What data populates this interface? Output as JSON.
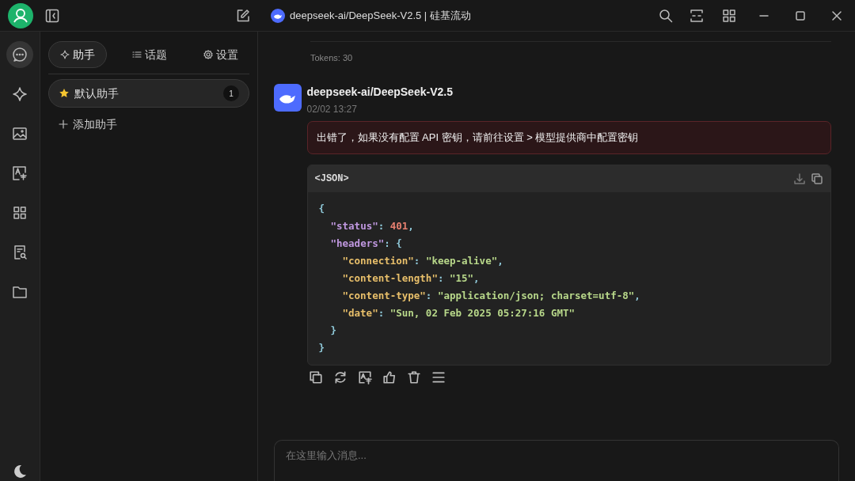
{
  "window": {
    "title": "deepseek-ai/DeepSeek-V2.5 | 硅基流动"
  },
  "rail": {
    "items": [
      {
        "kind": "chat",
        "selected": true
      },
      {
        "kind": "sparkle",
        "selected": false
      },
      {
        "kind": "image",
        "selected": false
      },
      {
        "kind": "translate",
        "selected": false
      },
      {
        "kind": "apps",
        "selected": false
      },
      {
        "kind": "doc-search",
        "selected": false
      },
      {
        "kind": "folder",
        "selected": false
      }
    ]
  },
  "panel": {
    "tabs": [
      {
        "kind": "assistants",
        "label": "助手",
        "selected": true
      },
      {
        "kind": "topics",
        "label": "话题",
        "selected": false
      },
      {
        "kind": "settings",
        "label": "设置",
        "selected": false
      }
    ],
    "assistants": [
      {
        "name": "默认助手",
        "count": "1",
        "selected": true
      }
    ],
    "add_label": "添加助手"
  },
  "chat": {
    "tokens": "Tokens: 30",
    "message": {
      "author": "deepseek-ai/DeepSeek-V2.5",
      "time": "02/02 13:27",
      "error": "出错了，如果没有配置 API 密钥，请前往设置 > 模型提供商中配置密钥",
      "code": {
        "language": "<JSON>",
        "lines": [
          {
            "tokens": [
              {
                "kind": "punct",
                "text": "{"
              }
            ],
            "children": [
              {
                "tokens": [
                  {
                    "kind": "key",
                    "text": "\"status\""
                  },
                  {
                    "kind": "punct",
                    "text": ": "
                  },
                  {
                    "kind": "number",
                    "text": "401"
                  },
                  {
                    "kind": "punct",
                    "text": ","
                  }
                ]
              },
              {
                "tokens": [
                  {
                    "kind": "key",
                    "text": "\"headers\""
                  },
                  {
                    "kind": "punct",
                    "text": ": {"
                  }
                ],
                "children": [
                  {
                    "tokens": [
                      {
                        "kind": "subkey",
                        "text": "\"connection\""
                      },
                      {
                        "kind": "punct",
                        "text": ": "
                      },
                      {
                        "kind": "string",
                        "text": "\"keep-alive\""
                      },
                      {
                        "kind": "punct",
                        "text": ","
                      }
                    ]
                  },
                  {
                    "tokens": [
                      {
                        "kind": "subkey",
                        "text": "\"content-length\""
                      },
                      {
                        "kind": "punct",
                        "text": ": "
                      },
                      {
                        "kind": "string",
                        "text": "\"15\""
                      },
                      {
                        "kind": "punct",
                        "text": ","
                      }
                    ]
                  },
                  {
                    "tokens": [
                      {
                        "kind": "subkey",
                        "text": "\"content-type\""
                      },
                      {
                        "kind": "punct",
                        "text": ": "
                      },
                      {
                        "kind": "string",
                        "text": "\"application/json; charset=utf-8\""
                      },
                      {
                        "kind": "punct",
                        "text": ","
                      }
                    ]
                  },
                  {
                    "tokens": [
                      {
                        "kind": "subkey",
                        "text": "\"date\""
                      },
                      {
                        "kind": "punct",
                        "text": ": "
                      },
                      {
                        "kind": "string",
                        "text": "\"Sun, 02 Feb 2025 05:27:16 GMT\""
                      }
                    ]
                  }
                ]
              },
              {
                "tokens": [
                  {
                    "kind": "punct",
                    "text": "}"
                  }
                ]
              }
            ]
          },
          {
            "tokens": [
              {
                "kind": "punct",
                "text": "}"
              }
            ]
          }
        ]
      }
    },
    "input": {
      "placeholder": "在这里输入消息..."
    }
  }
}
